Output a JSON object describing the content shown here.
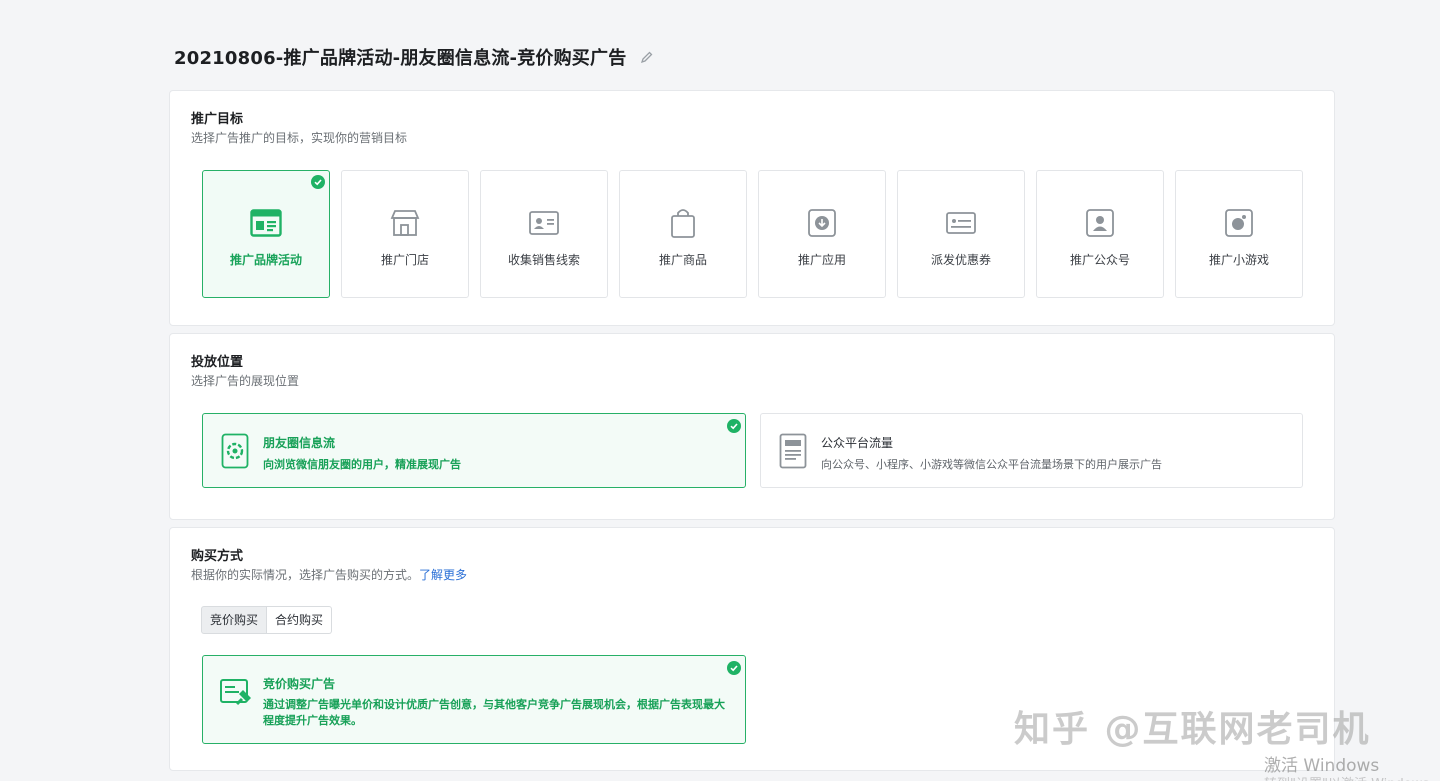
{
  "header": {
    "title": "20210806-推广品牌活动-朋友圈信息流-竞价购买广告",
    "edit_icon": "pencil-icon"
  },
  "objective_section": {
    "title": "推广目标",
    "desc": "选择广告推广的目标，实现你的营销目标",
    "selected": "推广品牌活动",
    "items": [
      {
        "label": "推广品牌活动",
        "icon": "browser-window-icon"
      },
      {
        "label": "推广门店",
        "icon": "store-icon"
      },
      {
        "label": "收集销售线索",
        "icon": "contact-card-icon"
      },
      {
        "label": "推广商品",
        "icon": "shopping-bag-icon"
      },
      {
        "label": "推广应用",
        "icon": "download-app-icon"
      },
      {
        "label": "派发优惠券",
        "icon": "coupon-icon"
      },
      {
        "label": "推广公众号",
        "icon": "official-account-icon"
      },
      {
        "label": "推广小游戏",
        "icon": "mini-game-icon"
      }
    ]
  },
  "placement_section": {
    "title": "投放位置",
    "desc": "选择广告的展现位置",
    "selected": "朋友圈信息流",
    "items": [
      {
        "name": "朋友圈信息流",
        "desc": "向浏览微信朋友圈的用户，精准展现广告",
        "icon": "moments-aperture-icon"
      },
      {
        "name": "公众平台流量",
        "desc": "向公众号、小程序、小游戏等微信公众平台流量场景下的用户展示广告",
        "icon": "article-page-icon"
      }
    ]
  },
  "buying_section": {
    "title": "购买方式",
    "desc": "根据你的实际情况，选择广告购买的方式。",
    "learn_more": "了解更多",
    "tabs": [
      "竞价购买",
      "合约购买"
    ],
    "active_tab": "竞价购买",
    "option": {
      "name": "竞价购买广告",
      "desc": "通过调整广告曝光单价和设计优质广告创意，与其他客户竞争广告展现机会，根据广告表现最大程度提升广告效果。",
      "icon": "bid-hammer-icon"
    }
  },
  "overlay": {
    "watermark": "知乎 @互联网老司机",
    "activate": "激活 Windows",
    "activate_sub": "转到\"设置\"以激活 Windows。"
  },
  "colors": {
    "accent": "#1fb265",
    "accent_text": "#18a158",
    "link": "#2a6fd6",
    "background": "#f4f5f7"
  }
}
